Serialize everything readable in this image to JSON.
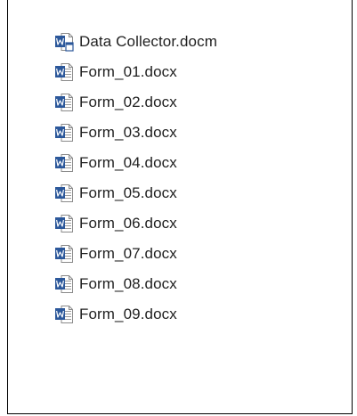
{
  "explorer": {
    "files": [
      {
        "name": "Data Collector.docm",
        "icon": "word-macro-document-icon"
      },
      {
        "name": "Form_01.docx",
        "icon": "word-document-icon"
      },
      {
        "name": "Form_02.docx",
        "icon": "word-document-icon"
      },
      {
        "name": "Form_03.docx",
        "icon": "word-document-icon"
      },
      {
        "name": "Form_04.docx",
        "icon": "word-document-icon"
      },
      {
        "name": "Form_05.docx",
        "icon": "word-document-icon"
      },
      {
        "name": "Form_06.docx",
        "icon": "word-document-icon"
      },
      {
        "name": "Form_07.docx",
        "icon": "word-document-icon"
      },
      {
        "name": "Form_08.docx",
        "icon": "word-document-icon"
      },
      {
        "name": "Form_09.docx",
        "icon": "word-document-icon"
      }
    ]
  },
  "colors": {
    "word_blue": "#2b579a",
    "page_border": "#8a8a8a",
    "text": "#1f1f1f",
    "frame": "#000000"
  }
}
